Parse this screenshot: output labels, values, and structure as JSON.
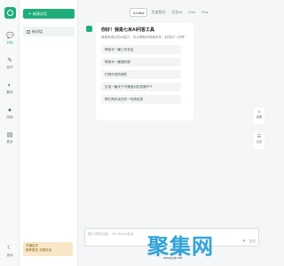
{
  "rail": {
    "items": [
      {
        "icon": "💬",
        "label": "对话",
        "icon_name": "chat-icon"
      },
      {
        "icon": "✎",
        "label": "创作",
        "icon_name": "feather-icon"
      },
      {
        "icon": "◐",
        "label": "翻译",
        "icon_name": "translate-icon"
      },
      {
        "icon": "●",
        "label": "绘画",
        "icon_name": "paint-icon"
      },
      {
        "icon": "▤",
        "label": "更多",
        "icon_name": "grid-icon"
      }
    ],
    "theme_label": "夜间"
  },
  "sessions": {
    "new_button": "新建对话",
    "items": [
      "新对话"
    ],
    "upgrade": {
      "line1": "开通会员",
      "line2": "畅享更多 无限对话"
    }
  },
  "main": {
    "model_tabs": [
      "AI-Mini",
      "百度智问",
      "豆包AI",
      "Kimi",
      "Plus"
    ],
    "greeting": {
      "title": "你好！我是七米AI问答工具",
      "desc": "我拥有强大的AI能力，可以帮助你快速写作，赶快试一试吧!"
    },
    "suggestions": [
      "帮我写一篇工作总结",
      "帮我写一篇落的规",
      "们例外的的请托",
      "生成一篇关于不要做对的发展PPT",
      "帮忙简历优化作一份原优质"
    ],
    "input_placeholder": "输入你的问题，Ctrl+Enter发送",
    "send_label": "发送",
    "footer": "此内容由AI生成，仅供参考"
  },
  "float": [
    {
      "icon": "☺",
      "label": "客服"
    },
    {
      "icon": "☰",
      "label": "反馈"
    }
  ],
  "watermark": {
    "text": "聚集网",
    "sub": "www.juji.net"
  },
  "colors": {
    "accent": "#1fae7a",
    "upgrade_bg": "#f8e7c8"
  }
}
